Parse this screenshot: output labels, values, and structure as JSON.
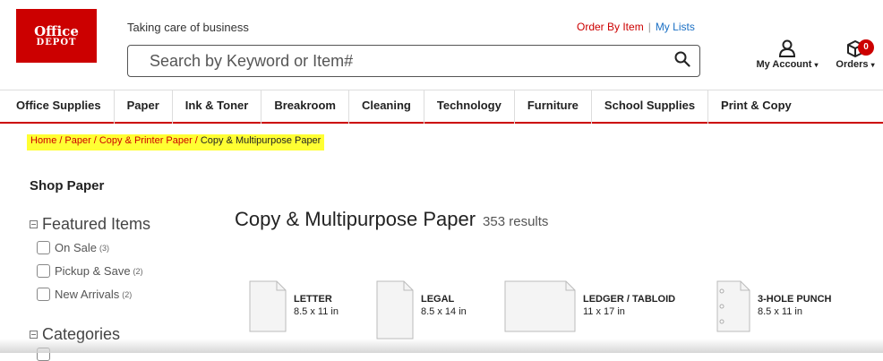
{
  "brand": {
    "line1": "Office",
    "line2": "DEPOT",
    "color": "#cc0000"
  },
  "header": {
    "tagline": "Taking care of business",
    "order_by_item": "Order By Item",
    "separator": "|",
    "my_lists": "My Lists",
    "search_placeholder": "Search by Keyword or Item#",
    "account_label": "My Account",
    "orders_label": "Orders",
    "orders_count": "0"
  },
  "nav": [
    "Office Supplies",
    "Paper",
    "Ink & Toner",
    "Breakroom",
    "Cleaning",
    "Technology",
    "Furniture",
    "School Supplies",
    "Print & Copy"
  ],
  "breadcrumb": {
    "items": [
      "Home",
      "Paper",
      "Copy & Printer Paper"
    ],
    "current": "Copy & Multipurpose Paper",
    "separator": "/"
  },
  "sidebar": {
    "title": "Shop Paper",
    "featured": {
      "title": "Featured Items",
      "options": [
        {
          "label": "On Sale",
          "count": "(3)"
        },
        {
          "label": "Pickup & Save",
          "count": "(2)"
        },
        {
          "label": "New Arrivals",
          "count": "(2)"
        }
      ]
    },
    "categories": {
      "title": "Categories"
    }
  },
  "main": {
    "title": "Copy & Multipurpose Paper",
    "results": "353 results",
    "sizes": [
      {
        "name": "LETTER",
        "dims": "8.5 x 11 in"
      },
      {
        "name": "LEGAL",
        "dims": "8.5 x 14 in"
      },
      {
        "name": "LEDGER / TABLOID",
        "dims": "11 x 17 in"
      },
      {
        "name": "3-HOLE PUNCH",
        "dims": "8.5 x 11 in"
      }
    ]
  }
}
